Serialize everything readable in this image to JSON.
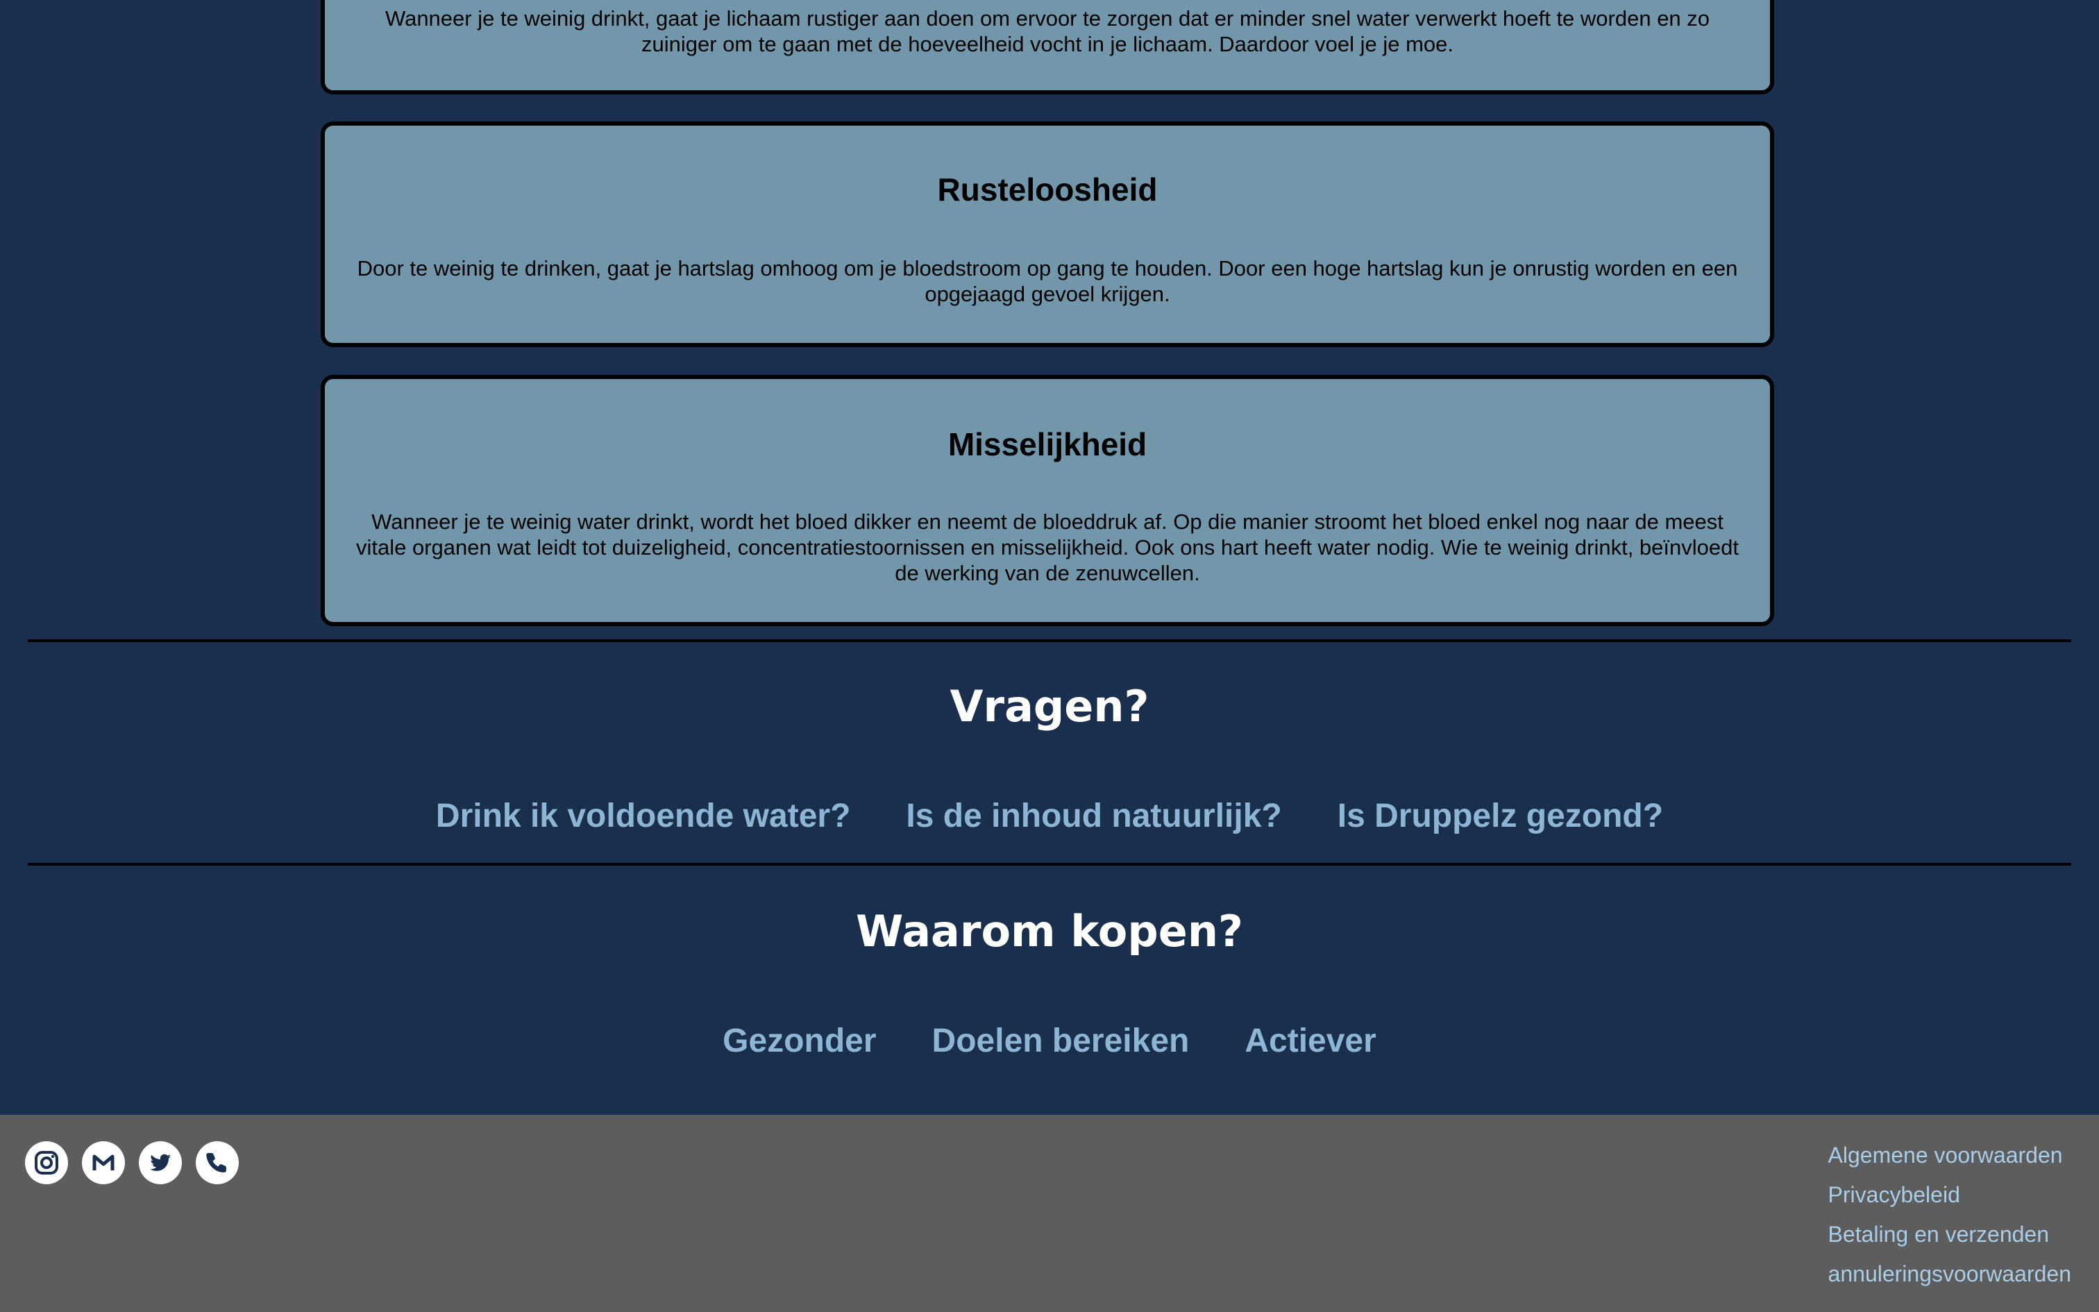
{
  "cards": [
    {
      "title": "",
      "text": "Wanneer je te weinig drinkt, gaat je lichaam rustiger aan doen om ervoor te zorgen dat er minder snel water verwerkt hoeft te worden en zo zuiniger om te gaan met de hoeveelheid vocht in je lichaam. Daardoor voel je je moe."
    },
    {
      "title": "Rusteloosheid",
      "text": "Door te weinig te drinken, gaat je hartslag omhoog om je bloedstroom op gang te houden. Door een hoge hartslag kun je onrustig worden en een opgejaagd gevoel krijgen."
    },
    {
      "title": "Misselijkheid",
      "text": "Wanneer je te weinig water drinkt, wordt het bloed dikker en neemt de bloeddruk af. Op die manier stroomt het bloed enkel nog naar de meest vitale organen wat leidt tot duizeligheid, concentratiestoornissen en misselijkheid. Ook ons hart heeft water nodig. Wie te weinig drinkt, beïnvloedt de werking van de zenuwcellen."
    }
  ],
  "vragen": {
    "title": "Vragen?",
    "links": [
      "Drink ik voldoende water?",
      "Is de inhoud natuurlijk?",
      "Is Druppelz gezond?"
    ]
  },
  "waarom": {
    "title": "Waarom kopen?",
    "links": [
      "Gezonder",
      "Doelen bereiken",
      "Actiever"
    ]
  },
  "footer": {
    "social_icons": [
      "instagram-icon",
      "mail-icon",
      "twitter-icon",
      "phone-icon"
    ],
    "links": [
      "Algemene voorwaarden",
      "Privacybeleid",
      "Betaling en verzenden",
      "annuleringsvoorwaarden"
    ]
  },
  "colors": {
    "page_background": "#1a2f4d",
    "card_background": "#7397aa",
    "link_color": "#8cb6d4",
    "footer_background": "#5d5d5d",
    "footer_link_color": "#a9cde6"
  }
}
